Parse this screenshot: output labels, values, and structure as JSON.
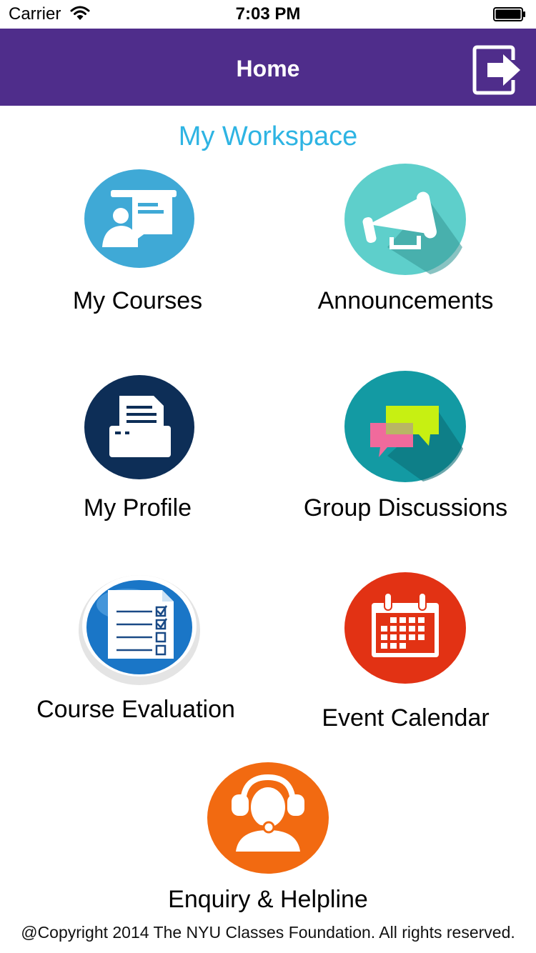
{
  "status_bar": {
    "carrier": "Carrier",
    "time": "7:03 PM",
    "wifi_icon": "wifi-icon",
    "battery_icon": "battery-icon"
  },
  "nav": {
    "title": "Home",
    "logout_icon": "logout-icon",
    "color": "#4f2d8b"
  },
  "workspace": {
    "title": "My Workspace",
    "title_color": "#2eb4e3"
  },
  "tiles": [
    {
      "label": "My Courses",
      "icon": "teacher-board-icon",
      "color": "#3fa9d6"
    },
    {
      "label": "Announcements",
      "icon": "megaphone-icon",
      "color": "#5ecfcb"
    },
    {
      "label": "My Profile",
      "icon": "printer-icon",
      "color": "#0d2e57"
    },
    {
      "label": "Group Discussions",
      "icon": "chat-bubbles-icon",
      "color": "#139aa3"
    },
    {
      "label": "Course Evaluation",
      "icon": "checklist-icon",
      "color": "#1a76c7"
    },
    {
      "label": "Event Calendar",
      "icon": "calendar-icon",
      "color": "#e23214"
    },
    {
      "label": "Enquiry & Helpline",
      "icon": "headset-support-icon",
      "color": "#f26a11"
    }
  ],
  "footer": {
    "copyright": "@Copyright 2014 The NYU Classes Foundation. All rights reserved."
  }
}
